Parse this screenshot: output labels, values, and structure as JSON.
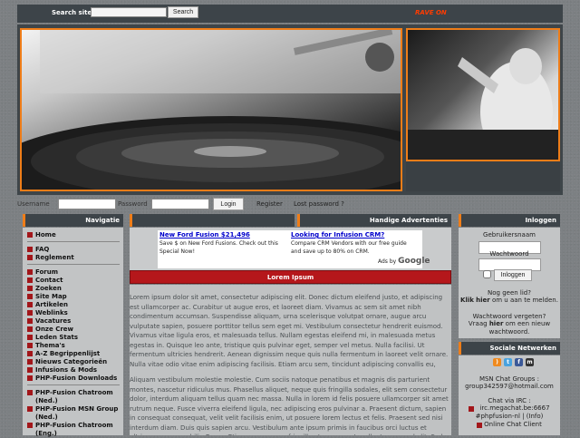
{
  "topbar": {
    "search_label": "Search site :",
    "search_button": "Search",
    "rave_text": "RAVE ON"
  },
  "login_bar": {
    "username_label": "Username",
    "password_label": "Password",
    "login_button": "Login",
    "register_link": "Register",
    "lost_password_link": "Lost password ?"
  },
  "nav": {
    "title": "Navigatie",
    "items": [
      {
        "label": "Home"
      },
      {
        "label": "FAQ"
      },
      {
        "label": "Reglement"
      },
      {
        "label": "Forum"
      },
      {
        "label": "Contact"
      },
      {
        "label": "Zoeken"
      },
      {
        "label": "Site Map"
      },
      {
        "label": "Artikelen"
      },
      {
        "label": "Weblinks"
      },
      {
        "label": "Vacatures"
      },
      {
        "label": "Onze Crew"
      },
      {
        "label": "Leden Stats"
      },
      {
        "label": "Thema's"
      },
      {
        "label": "A-Z Begrippenlijst"
      },
      {
        "label": "Nieuws Categorieën"
      },
      {
        "label": "Infusions & Mods"
      },
      {
        "label": "PHP-Fusion Downloads"
      },
      {
        "label": "PHP-Fusion Chatroom (Ned.)"
      },
      {
        "label": "PHP-Fusion MSN Group (Ned.)"
      },
      {
        "label": "PHP-Fusion Chatroom (Eng.)"
      }
    ]
  },
  "ads": {
    "header": "Handige Advertenties",
    "ad1_title": "New Ford Fusion $21,496",
    "ad1_text": "Save $ on New Ford Fusions. Check out this Special Now!",
    "ad2_title": "Looking for Infusion CRM?",
    "ad2_text": "Compare CRM Vendors with our free guide and save up to 80% on CRM.",
    "ads_by": "Ads by",
    "google": "Google"
  },
  "article": {
    "title": "Lorem Ipsum",
    "para1": "Lorem ipsum dolor sit amet, consectetur adipiscing elit. Donec dictum eleifend justo, et adipiscing est ullamcorper ac. Curabitur ut augue eros, et laoreet diam. Vivamus ac sem sit amet nibh condimentum accumsan. Suspendisse aliquam, urna scelerisque volutpat ornare, augue arcu vulputate sapien, posuere porttitor tellus sem eget mi. Vestibulum consectetur hendrerit euismod. Vivamus vitae ligula eros, et malesuada tellus. Nullam egestas eleifend mi, in malesuada metus egestas in. Quisque leo ante, tristique quis pulvinar eget, semper vel metus. Nulla facilisi. Ut fermentum ultricies hendrerit. Aenean dignissim neque quis nulla fermentum in laoreet velit ornare. Nulla vitae odio vitae enim adipiscing facilisis. Etiam arcu sem, tincidunt adipiscing convallis eu, facilisis interdum nisi. Phasellus ut dui a mi varius vestibulum.",
    "para2": "Aliquam vestibulum molestie molestie. Cum sociis natoque penatibus et magnis dis parturient montes, nascetur ridiculus mus. Phasellus aliquet, neque quis fringilla sodales, elit sem consectetur dolor, interdum aliquam tellus quam nec massa. Nulla in lorem id felis posuere ullamcorper sit amet rutrum neque. Fusce viverra eleifend ligula, nec adipiscing eros pulvinar a. Praesent dictum, sapien in consequat consequat, velit velit facilisis enim, ut posuere lorem lectus et felis. Praesent sed nisi interdum diam. Duis quis sapien arcu. Vestibulum ante ipsum primis in faucibus orci luctus et ultrices posuere cubilia Curae; Etiam nunc quam, fringilla et posuere ut, pellentesque sed elit. Sed vel lacus"
  },
  "login_box": {
    "title": "Inloggen",
    "username_label": "Gebruikersnaam",
    "password_label": "Wachtwoord",
    "signin_button": "Inloggen",
    "not_member": "Nog geen lid?",
    "click": "Klik",
    "here": "hier",
    "register_suffix": "om u aan te melden.",
    "forgot": "Wachtwoord vergeten?",
    "ask": "Vraag",
    "ask_here": "hier",
    "ask_suffix": "om een nieuw wachtwoord."
  },
  "social": {
    "title": "Sociale Netwerken",
    "icons": [
      "rss-icon",
      "twitter-icon",
      "facebook-icon",
      "myspace-icon"
    ],
    "msn_label": "MSN Chat Groups :",
    "msn_address": "group342597@hotmail.com",
    "irc_label": "Chat via IRC :",
    "irc_server": "irc.megachat.be:6667",
    "irc_channel": "#phpfusion-nl | (Info)",
    "online_chat": "Online Chat Client"
  },
  "colors": {
    "accent": "#ef7d18",
    "header_bg": "#3d4449",
    "article_header": "#b5171b",
    "bullet": "#a2161a"
  }
}
